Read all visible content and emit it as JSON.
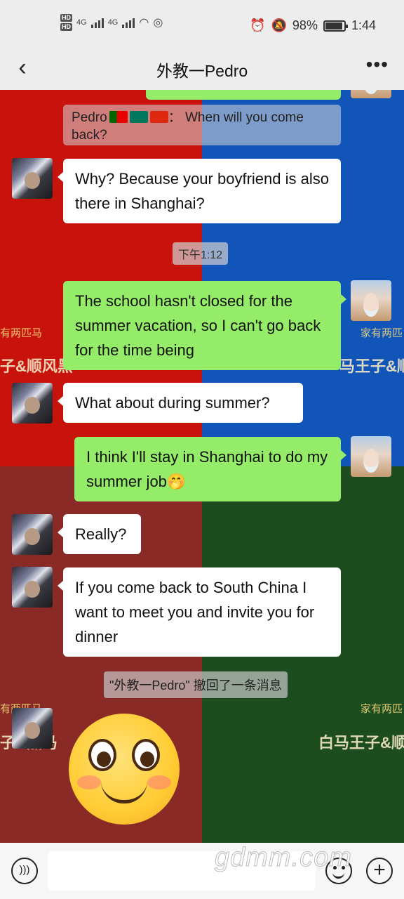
{
  "status_bar": {
    "network_left": [
      "HD",
      "HD"
    ],
    "signal_1": "4G",
    "signal_2": "4G",
    "battery": "98%",
    "time": "1:44"
  },
  "header": {
    "title": "外教一Pedro",
    "more": "•••",
    "back": "‹"
  },
  "background_watermarks": [
    "有两匹马",
    "子&顺风黑",
    "家有两匹",
    "马王子&顺",
    "有两匹马",
    "子&黑马",
    "家有两匹",
    "白马王子&顺"
  ],
  "messages": {
    "quote": {
      "sender": "Pedro",
      "separator": "：",
      "text": "When will you come back?"
    },
    "m1": "Why? Because your boyfriend is also there in Shanghai?",
    "timestamp": "下午1:12",
    "m2": "The school hasn't closed for the summer vacation, so I can't go back for the time being",
    "m3": "What about during summer?",
    "m4": "I think I'll stay in Shanghai to do my summer job",
    "m4_emoji": "🤭",
    "m5": "Really?",
    "m6": "If you come back to South China I want to meet you and invite you for dinner",
    "recall_note": "\"外教一Pedro\" 撤回了一条消息"
  },
  "input_bar": {
    "voice_icon": "voice-icon",
    "placeholder": "",
    "plus": "+",
    "watermark": "gdmm.com"
  },
  "colors": {
    "outgoing_bubble": "#95ec69",
    "incoming_bubble": "#ffffff",
    "bg_red": "#c8120c",
    "bg_blue": "#1155b8",
    "bg_maroon": "#8a2a26",
    "bg_green": "#1d4d1f"
  }
}
